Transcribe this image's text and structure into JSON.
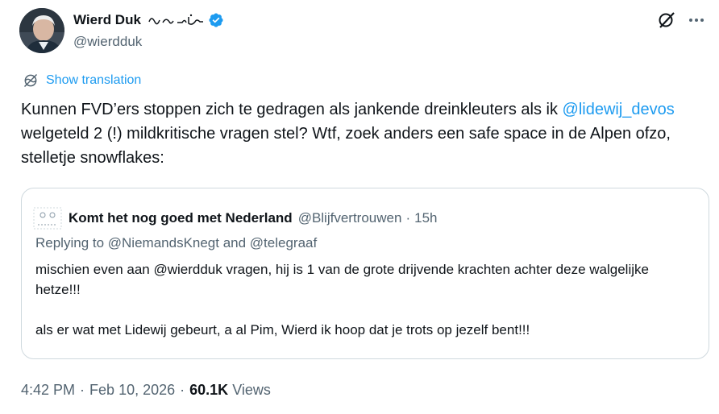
{
  "author": {
    "display_name": "Wierd Duk",
    "handle": "@wierdduk",
    "verified": true
  },
  "icons": {
    "verified": "verified-badge-icon",
    "grok": "grok-icon",
    "more": "more-options-icon",
    "translate": "globe-icon"
  },
  "translate_label": "Show translation",
  "tweet": {
    "text_part1": "Kunnen FVD’ers stoppen zich te gedragen als jankende dreinkleuters als ik ",
    "mention": "@lidewij_devos",
    "text_part2": " welgeteld 2 (!) mildkritische vragen stel? Wtf, zoek anders een safe space in de Alpen ofzo, stelletje snowflakes:"
  },
  "quoted": {
    "name": "Komt het nog goed met Nederland",
    "handle": "@Blijfvertrouwen",
    "separator": "·",
    "time": "15h",
    "replying_to": "Replying to @NiemandsKnegt and @telegraaf",
    "paragraph1": "mischien even aan @wierdduk vragen, hij is 1 van de grote drijvende krachten achter deze walgelijke hetze!!!",
    "paragraph2": "als er wat met Lidewij gebeurt, a al Pim, Wierd ik hoop dat je trots op jezelf bent!!!"
  },
  "meta": {
    "time": "4:42 PM",
    "separator": "·",
    "date": "Feb 10, 2026",
    "separator2": "·",
    "views_count": "60.1K",
    "views_label": "Views"
  },
  "colors": {
    "accent": "#1d9bf0",
    "text": "#0f1419",
    "secondary": "#536471",
    "border": "#cfd9de"
  }
}
